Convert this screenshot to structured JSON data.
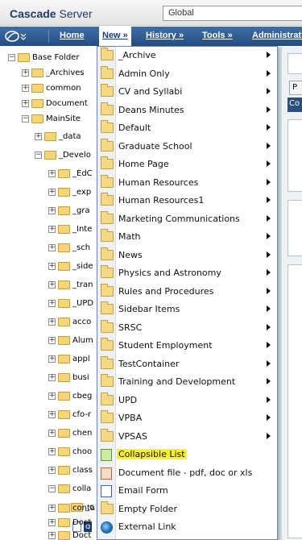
{
  "header": {
    "app_title_bold": "Cascade",
    "app_title_rest": " Server",
    "site_selector_value": "Global"
  },
  "navbar": {
    "items": [
      {
        "label": "Home"
      },
      {
        "label": "New »"
      },
      {
        "label": "History »"
      },
      {
        "label": "Tools »"
      },
      {
        "label": "Administrati"
      }
    ]
  },
  "tree": {
    "rows": [
      {
        "label": "Base Folder",
        "toggle": "−"
      },
      {
        "label": "_Archives",
        "toggle": "+"
      },
      {
        "label": "common",
        "toggle": "+"
      },
      {
        "label": "Document",
        "toggle": "+"
      },
      {
        "label": "MainSite",
        "toggle": "−"
      },
      {
        "label": "_data",
        "toggle": "+"
      },
      {
        "label": "_Develo",
        "toggle": "−"
      },
      {
        "label": "_EdC",
        "toggle": "+"
      },
      {
        "label": "_exp",
        "toggle": "+"
      },
      {
        "label": "_gra",
        "toggle": "+"
      },
      {
        "label": "_Inte",
        "toggle": "+"
      },
      {
        "label": "_sch",
        "toggle": "+"
      },
      {
        "label": "_side",
        "toggle": "+"
      },
      {
        "label": "_tran",
        "toggle": "+"
      },
      {
        "label": "_UPD",
        "toggle": "+"
      },
      {
        "label": "acco",
        "toggle": "+"
      },
      {
        "label": "Alum",
        "toggle": "+"
      },
      {
        "label": "appl",
        "toggle": "+"
      },
      {
        "label": "busi",
        "toggle": "+"
      },
      {
        "label": "cbeg",
        "toggle": "+"
      },
      {
        "label": "cfo-r",
        "toggle": "+"
      },
      {
        "label": "chen",
        "toggle": "+"
      },
      {
        "label": "choo",
        "toggle": "+"
      },
      {
        "label": "class",
        "toggle": "+"
      },
      {
        "label": "colla",
        "toggle": "−"
      },
      {
        "label": "_c",
        "toggle": "+"
      },
      {
        "label": "d",
        "toggle": ""
      },
      {
        "label": "conta",
        "toggle": "+"
      },
      {
        "label": "Doct",
        "toggle": "+"
      },
      {
        "label": "Doct",
        "toggle": "+"
      },
      {
        "label": "Doct",
        "toggle": "+"
      }
    ]
  },
  "right_pane": {
    "tab_label": "P",
    "band_label": "Co"
  },
  "new_menu": {
    "items": [
      {
        "label": "_Archive",
        "icon": "folder-icon",
        "submenu": true
      },
      {
        "label": "Admin Only",
        "icon": "folder-icon",
        "submenu": true
      },
      {
        "label": "CV and Syllabi",
        "icon": "folder-icon",
        "submenu": true
      },
      {
        "label": "Deans Minutes",
        "icon": "folder-icon",
        "submenu": true
      },
      {
        "label": "Default",
        "icon": "folder-icon",
        "submenu": true
      },
      {
        "label": "Graduate School",
        "icon": "folder-icon",
        "submenu": true
      },
      {
        "label": "Home Page",
        "icon": "folder-icon",
        "submenu": true
      },
      {
        "label": "Human Resources",
        "icon": "folder-icon",
        "submenu": true
      },
      {
        "label": "Human Resources1",
        "icon": "folder-icon",
        "submenu": true
      },
      {
        "label": "Marketing Communications",
        "icon": "folder-icon",
        "submenu": true
      },
      {
        "label": "Math",
        "icon": "folder-icon",
        "submenu": true
      },
      {
        "label": "News",
        "icon": "folder-icon",
        "submenu": true
      },
      {
        "label": "Physics and Astronomy",
        "icon": "folder-icon",
        "submenu": true
      },
      {
        "label": "Rules and Procedures",
        "icon": "folder-icon",
        "submenu": true
      },
      {
        "label": "Sidebar Items",
        "icon": "folder-icon",
        "submenu": true
      },
      {
        "label": "SRSC",
        "icon": "folder-icon",
        "submenu": true
      },
      {
        "label": "Student Employment",
        "icon": "folder-icon",
        "submenu": true
      },
      {
        "label": "TestContainer",
        "icon": "folder-icon",
        "submenu": true
      },
      {
        "label": "Training and Development",
        "icon": "folder-icon",
        "submenu": true
      },
      {
        "label": "UPD",
        "icon": "folder-icon",
        "submenu": true
      },
      {
        "label": "VPBA",
        "icon": "folder-icon",
        "submenu": true
      },
      {
        "label": "VPSAS",
        "icon": "folder-icon",
        "submenu": true
      },
      {
        "label": "Collapsible List",
        "icon": "page-icon",
        "submenu": false,
        "highlighted": true
      },
      {
        "label": "Document file - pdf, doc or xls",
        "icon": "file-icon",
        "submenu": false
      },
      {
        "label": "Email Form",
        "icon": "form-icon",
        "submenu": false
      },
      {
        "label": "Empty Folder",
        "icon": "folder-icon",
        "submenu": false
      },
      {
        "label": "External Link",
        "icon": "globe-icon",
        "submenu": false
      }
    ]
  },
  "colors": {
    "nav_blue": "#2a5690",
    "highlight": "#f6f12a",
    "selected_row": "#1a3d6c"
  }
}
